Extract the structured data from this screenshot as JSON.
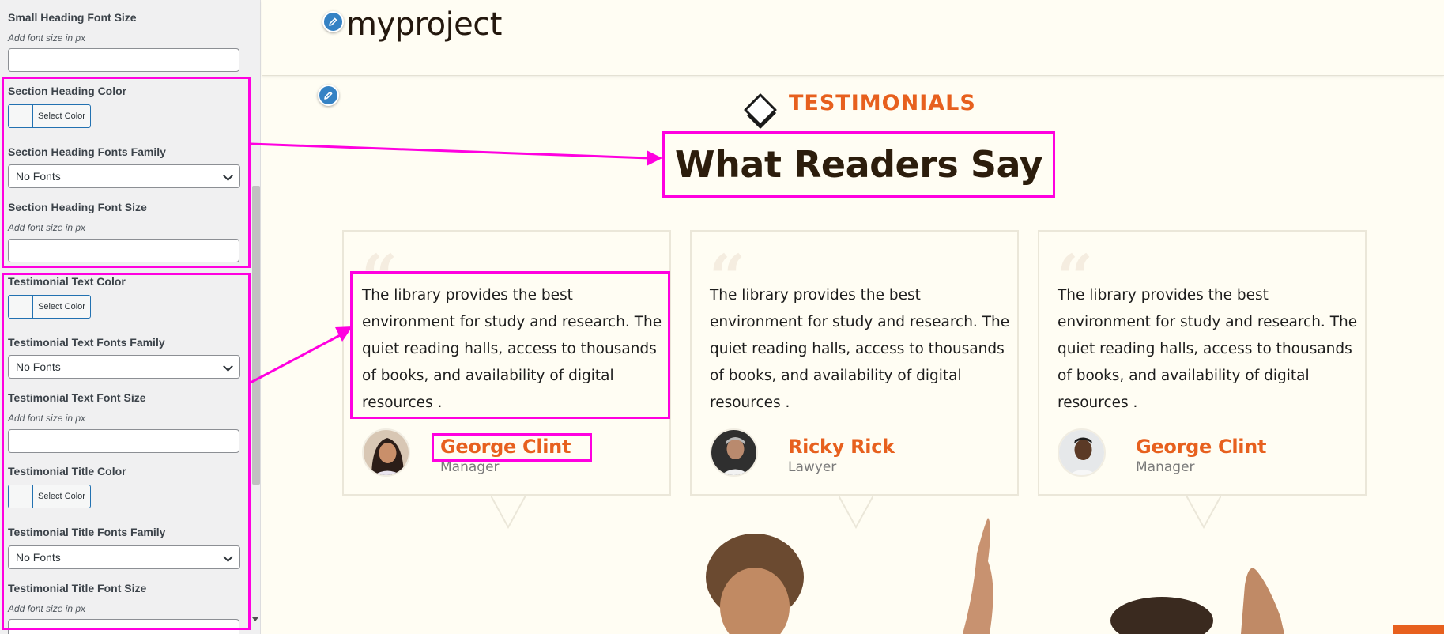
{
  "sidebar": {
    "small_heading_font_size": {
      "label": "Small Heading Font Size",
      "description": "Add font size in px",
      "value": ""
    },
    "section_heading_color": {
      "label": "Section Heading Color",
      "button": "Select Color"
    },
    "section_heading_fonts_family": {
      "label": "Section Heading Fonts Family",
      "selected": "No Fonts"
    },
    "section_heading_font_size": {
      "label": "Section Heading Font Size",
      "description": "Add font size in px",
      "value": ""
    },
    "testimonial_text_color": {
      "label": "Testimonial Text Color",
      "button": "Select Color"
    },
    "testimonial_text_fonts_family": {
      "label": "Testimonial Text Fonts Family",
      "selected": "No Fonts"
    },
    "testimonial_text_font_size": {
      "label": "Testimonial Text Font Size",
      "description": "Add font size in px",
      "value": ""
    },
    "testimonial_title_color": {
      "label": "Testimonial Title Color",
      "button": "Select Color"
    },
    "testimonial_title_fonts_family": {
      "label": "Testimonial Title Fonts Family",
      "selected": "No Fonts"
    },
    "testimonial_title_font_size": {
      "label": "Testimonial Title Font Size",
      "description": "Add font size in px",
      "value": ""
    }
  },
  "preview": {
    "site_title": "myproject",
    "kicker": "TESTIMONIALS",
    "heading": "What Readers Say",
    "testimonials": [
      {
        "text": "The library provides the best environment for study and research. The quiet reading halls, access to thousands of books, and availability of digital resources .",
        "name": "George Clint",
        "role": "Manager"
      },
      {
        "text": "The library provides the best environment for study and research. The quiet reading halls, access to thousands of books, and availability of digital resources .",
        "name": "Ricky Rick",
        "role": "Lawyer"
      },
      {
        "text": "The library provides the best environment for study and research. The quiet reading halls, access to thousands of books, and availability of digital resources .",
        "name": "George Clint",
        "role": "Manager"
      }
    ]
  },
  "colors": {
    "accent": "#e7601e",
    "heading": "#2c1d0c",
    "annotation": "#ff00e0",
    "edit_icon": "#3582c4"
  },
  "icons": [
    "pencil-icon",
    "quote-icon",
    "book-icon",
    "chevron-down-icon"
  ]
}
